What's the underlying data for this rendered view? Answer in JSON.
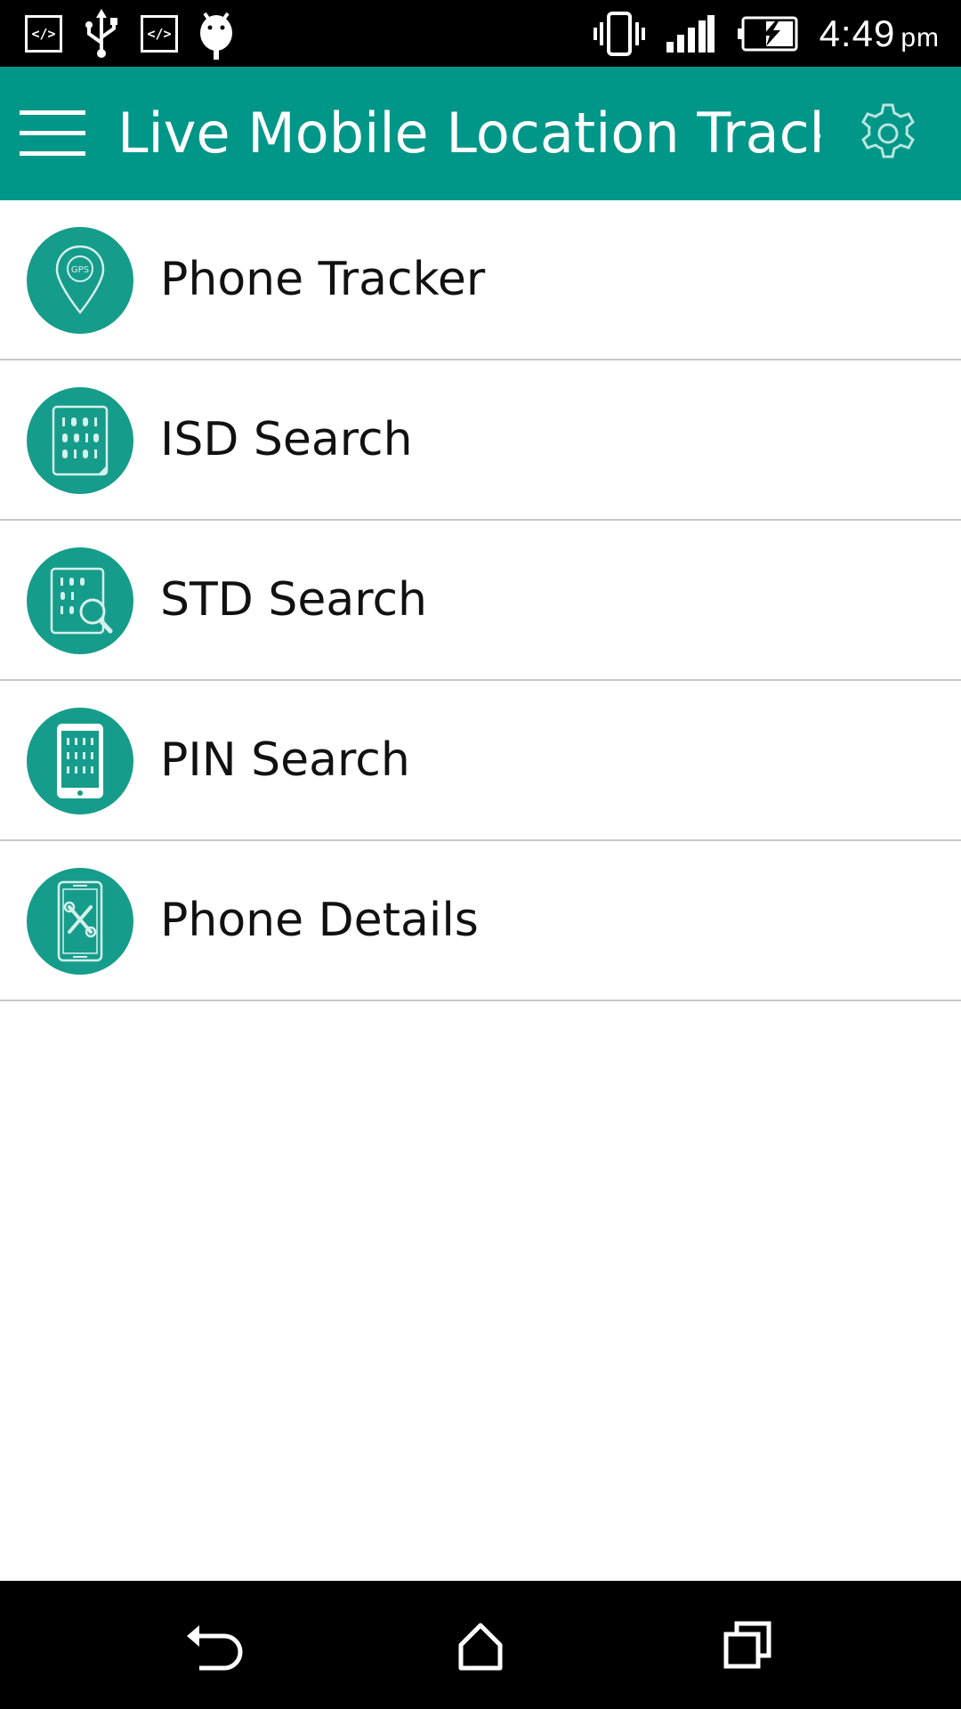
{
  "status_bar": {
    "left_icons": [
      "code-icon",
      "usb-icon",
      "code-icon",
      "android-debug-icon"
    ],
    "code_glyph": "</>",
    "right_icons": [
      "vibrate-icon",
      "signal-icon",
      "battery-charging-icon"
    ],
    "time": "4:49",
    "ampm": "pm"
  },
  "app_bar": {
    "title": "Live Mobile Location Track",
    "menu_icon": "hamburger-menu-icon",
    "settings_icon": "gear-icon",
    "color": "#009688"
  },
  "menu_items": [
    {
      "label": "Phone Tracker",
      "icon": "gps-pin-icon",
      "icon_text": "GPS"
    },
    {
      "label": "ISD Search",
      "icon": "code-document-icon"
    },
    {
      "label": "STD Search",
      "icon": "document-search-icon"
    },
    {
      "label": "PIN Search",
      "icon": "phone-keypad-icon"
    },
    {
      "label": "Phone Details",
      "icon": "phone-tools-icon"
    }
  ],
  "nav_bar": {
    "back_icon": "back-icon",
    "home_icon": "home-icon",
    "recents_icon": "recents-icon"
  },
  "colors": {
    "accent": "#009688",
    "icon_circle": "#169c8b",
    "divider": "#c8c8c8"
  }
}
